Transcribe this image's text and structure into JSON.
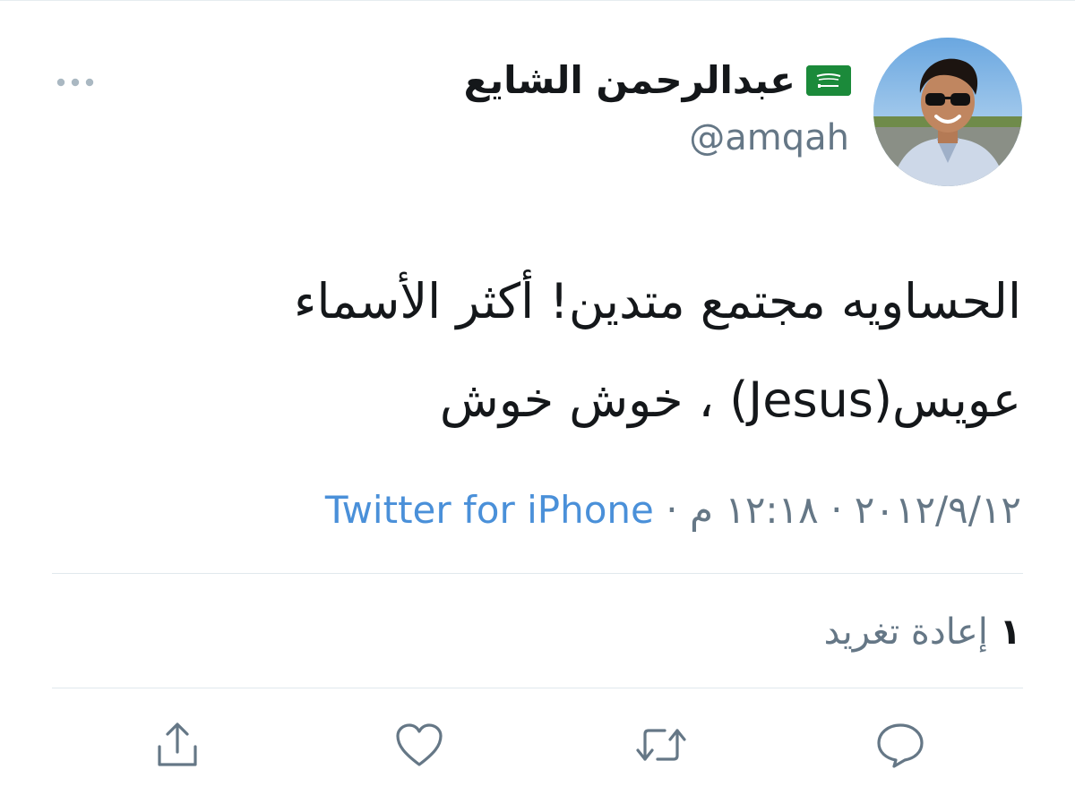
{
  "author": {
    "display_name": "عبدالرحمن الشايع",
    "handle": "@amqah",
    "flag_icon": "saudi-flag-icon",
    "avatar": "profile-photo"
  },
  "tweet": {
    "line1": "الحساويه مجتمع متدين! أكثر الأسماء",
    "line2": "عويس(Jesus) ، خوش خوش"
  },
  "meta": {
    "date": "٢٠١٢/٩/١٢",
    "separator": "·",
    "time": "١٢:١٨ م",
    "source": "Twitter for iPhone"
  },
  "stats": {
    "retweet_count": "١",
    "retweet_label": "إعادة تغريد"
  },
  "actions": {
    "reply_icon": "reply-icon",
    "retweet_icon": "retweet-icon",
    "like_icon": "heart-icon",
    "share_icon": "share-icon",
    "more_icon": "more-icon"
  },
  "colors": {
    "text": "#14171a",
    "secondary": "#657786",
    "link": "#4a90d9",
    "divider": "#e1e8ed"
  }
}
